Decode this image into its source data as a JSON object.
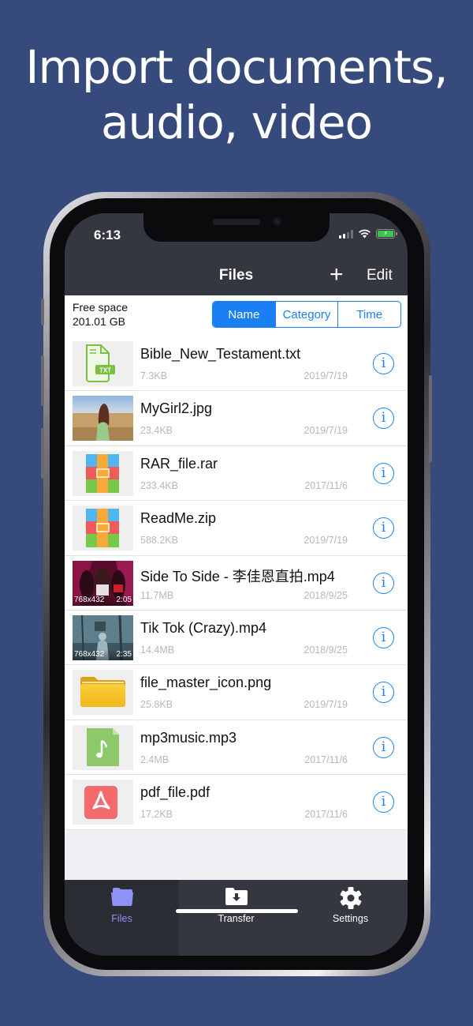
{
  "headline": {
    "line1": "Import documents,",
    "line2": "audio, video"
  },
  "status_bar": {
    "time": "6:13",
    "signal_icon": "cellular-signal-icon",
    "wifi_icon": "wifi-icon",
    "battery_icon": "battery-charging-icon"
  },
  "navbar": {
    "title": "Files",
    "add_label": "+",
    "edit_label": "Edit"
  },
  "storage": {
    "label": "Free space",
    "value": "201.01 GB"
  },
  "sort_segments": {
    "options": [
      "Name",
      "Category",
      "Time"
    ],
    "selected": "Name"
  },
  "files": [
    {
      "name": "Bible_New_Testament.txt",
      "size": "7.3KB",
      "date": "2019/7/19",
      "icon": "txt-file-icon"
    },
    {
      "name": "MyGirl2.jpg",
      "size": "23.4KB",
      "date": "2019/7/19",
      "icon": "image-thumbnail"
    },
    {
      "name": "RAR_file.rar",
      "size": "233.4KB",
      "date": "2017/11/6",
      "icon": "archive-file-icon"
    },
    {
      "name": "ReadMe.zip",
      "size": "588.2KB",
      "date": "2019/7/19",
      "icon": "archive-file-icon"
    },
    {
      "name": "Side To Side - 李佳恩直拍.mp4",
      "size": "11.7MB",
      "date": "2018/9/25",
      "icon": "video-thumbnail",
      "resolution": "768x432",
      "duration": "2:05"
    },
    {
      "name": "Tik Tok (Crazy).mp4",
      "size": "14.4MB",
      "date": "2018/9/25",
      "icon": "video-thumbnail",
      "resolution": "768x432",
      "duration": "2:35"
    },
    {
      "name": "file_master_icon.png",
      "size": "25.8KB",
      "date": "2019/7/19",
      "icon": "folder-image-icon"
    },
    {
      "name": "mp3music.mp3",
      "size": "2.4MB",
      "date": "2017/11/6",
      "icon": "audio-file-icon"
    },
    {
      "name": "pdf_file.pdf",
      "size": "17.2KB",
      "date": "2017/11/6",
      "icon": "pdf-file-icon"
    }
  ],
  "info_glyph": "i",
  "tabbar": {
    "tabs": [
      {
        "label": "Files",
        "icon": "folder-icon",
        "active": true
      },
      {
        "label": "Transfer",
        "icon": "download-folder-icon",
        "active": false
      },
      {
        "label": "Settings",
        "icon": "gear-icon",
        "active": false
      }
    ]
  },
  "colors": {
    "background": "#364a7c",
    "accent": "#1a7ff5",
    "active_tab": "#8f91f5",
    "bar": "#34373f"
  }
}
